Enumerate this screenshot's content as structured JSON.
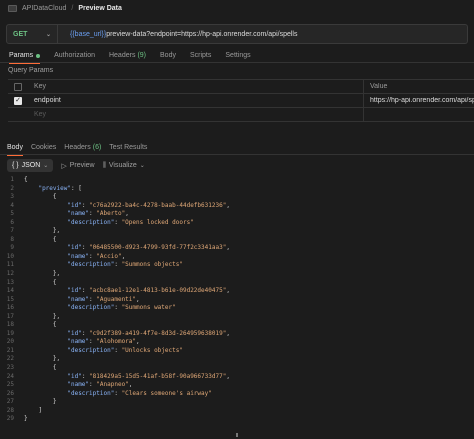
{
  "breadcrumb": {
    "collection": "APIDataCloud",
    "separator": "/",
    "request": "Preview Data"
  },
  "request": {
    "method": "GET",
    "url_variable": "{{base_url}}",
    "url_rest": "preview-data?endpoint=https://hp-api.onrender.com/api/spells"
  },
  "request_tabs": {
    "params": "Params",
    "authorization": "Authorization",
    "headers": "Headers",
    "headers_count": "(9)",
    "body": "Body",
    "scripts": "Scripts",
    "settings": "Settings"
  },
  "query_params": {
    "title": "Query Params",
    "key_header": "Key",
    "value_header": "Value",
    "rows": [
      {
        "key": "endpoint",
        "value": "https://hp-api.onrender.com/api/spells"
      }
    ],
    "key_placeholder": "Key"
  },
  "response_tabs": {
    "body": "Body",
    "cookies": "Cookies",
    "headers": "Headers",
    "headers_count": "(6)",
    "test_results": "Test Results"
  },
  "response_toolbar": {
    "format_icon": "{ }",
    "format": "JSON",
    "preview": "Preview",
    "visualize": "Visualize"
  },
  "code_lines": [
    [
      [
        "p",
        "{"
      ]
    ],
    [
      [
        "p",
        "    "
      ],
      [
        "k",
        "\"preview\""
      ],
      [
        "p",
        ": ["
      ]
    ],
    [
      [
        "p",
        "        {"
      ]
    ],
    [
      [
        "p",
        "            "
      ],
      [
        "k",
        "\"id\""
      ],
      [
        "p",
        ": "
      ],
      [
        "s",
        "\"c76a2922-ba4c-4278-baab-44defb631236\""
      ],
      [
        "p",
        ","
      ]
    ],
    [
      [
        "p",
        "            "
      ],
      [
        "k",
        "\"name\""
      ],
      [
        "p",
        ": "
      ],
      [
        "s",
        "\"Aberto\""
      ],
      [
        "p",
        ","
      ]
    ],
    [
      [
        "p",
        "            "
      ],
      [
        "k",
        "\"description\""
      ],
      [
        "p",
        ": "
      ],
      [
        "s",
        "\"Opens locked doors\""
      ]
    ],
    [
      [
        "p",
        "        },"
      ]
    ],
    [
      [
        "p",
        "        {"
      ]
    ],
    [
      [
        "p",
        "            "
      ],
      [
        "k",
        "\"id\""
      ],
      [
        "p",
        ": "
      ],
      [
        "s",
        "\"06485500-d923-4799-93fd-77f2c3341aa3\""
      ],
      [
        "p",
        ","
      ]
    ],
    [
      [
        "p",
        "            "
      ],
      [
        "k",
        "\"name\""
      ],
      [
        "p",
        ": "
      ],
      [
        "s",
        "\"Accio\""
      ],
      [
        "p",
        ","
      ]
    ],
    [
      [
        "p",
        "            "
      ],
      [
        "k",
        "\"description\""
      ],
      [
        "p",
        ": "
      ],
      [
        "s",
        "\"Summons objects\""
      ]
    ],
    [
      [
        "p",
        "        },"
      ]
    ],
    [
      [
        "p",
        "        {"
      ]
    ],
    [
      [
        "p",
        "            "
      ],
      [
        "k",
        "\"id\""
      ],
      [
        "p",
        ": "
      ],
      [
        "s",
        "\"acbc8ae1-12e1-4813-b61e-09d22de40475\""
      ],
      [
        "p",
        ","
      ]
    ],
    [
      [
        "p",
        "            "
      ],
      [
        "k",
        "\"name\""
      ],
      [
        "p",
        ": "
      ],
      [
        "s",
        "\"Aguamenti\""
      ],
      [
        "p",
        ","
      ]
    ],
    [
      [
        "p",
        "            "
      ],
      [
        "k",
        "\"description\""
      ],
      [
        "p",
        ": "
      ],
      [
        "s",
        "\"Summons water\""
      ]
    ],
    [
      [
        "p",
        "        },"
      ]
    ],
    [
      [
        "p",
        "        {"
      ]
    ],
    [
      [
        "p",
        "            "
      ],
      [
        "k",
        "\"id\""
      ],
      [
        "p",
        ": "
      ],
      [
        "s",
        "\"c9d2f389-a419-4f7e-8d3d-264959638019\""
      ],
      [
        "p",
        ","
      ]
    ],
    [
      [
        "p",
        "            "
      ],
      [
        "k",
        "\"name\""
      ],
      [
        "p",
        ": "
      ],
      [
        "s",
        "\"Alohomora\""
      ],
      [
        "p",
        ","
      ]
    ],
    [
      [
        "p",
        "            "
      ],
      [
        "k",
        "\"description\""
      ],
      [
        "p",
        ": "
      ],
      [
        "s",
        "\"Unlocks objects\""
      ]
    ],
    [
      [
        "p",
        "        },"
      ]
    ],
    [
      [
        "p",
        "        {"
      ]
    ],
    [
      [
        "p",
        "            "
      ],
      [
        "k",
        "\"id\""
      ],
      [
        "p",
        ": "
      ],
      [
        "s",
        "\"818429a5-15d5-41af-b58f-90a966733d77\""
      ],
      [
        "p",
        ","
      ]
    ],
    [
      [
        "p",
        "            "
      ],
      [
        "k",
        "\"name\""
      ],
      [
        "p",
        ": "
      ],
      [
        "s",
        "\"Anapneo\""
      ],
      [
        "p",
        ","
      ]
    ],
    [
      [
        "p",
        "            "
      ],
      [
        "k",
        "\"description\""
      ],
      [
        "p",
        ": "
      ],
      [
        "s",
        "\"Clears someone's airway\""
      ]
    ],
    [
      [
        "p",
        "        }"
      ]
    ],
    [
      [
        "p",
        "    ]"
      ]
    ],
    [
      [
        "p",
        "}"
      ]
    ]
  ],
  "colors": {
    "background": "#1c1c1c",
    "method_get": "#6cc083",
    "variable": "#6a9ef0",
    "json_key": "#8ab4f8",
    "json_string": "#e0a877",
    "active_tab_underline": "#ff6c37"
  }
}
